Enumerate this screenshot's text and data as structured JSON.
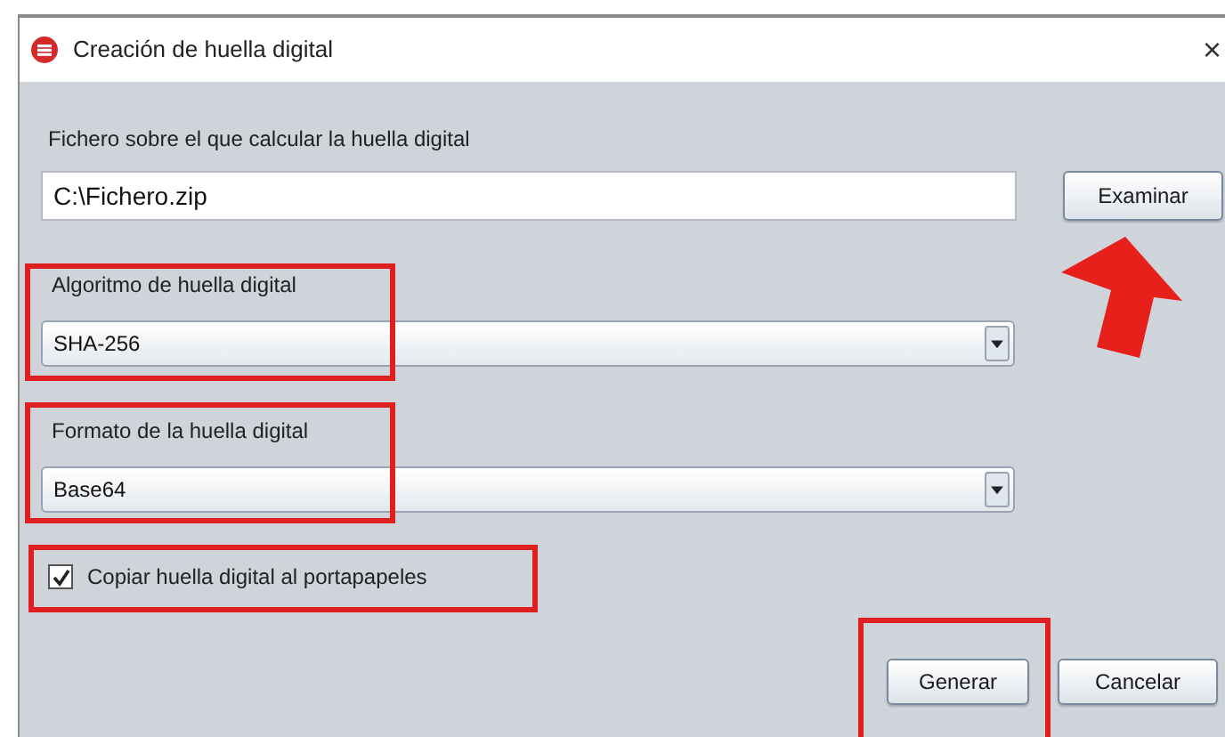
{
  "window": {
    "title": "Creación de huella digital",
    "close": "×"
  },
  "file": {
    "label": "Fichero sobre el que calcular la huella digital",
    "value": "C:\\Fichero.zip",
    "browse_button": "Examinar"
  },
  "selects": [
    {
      "label": "Algoritmo de huella digital",
      "value": "SHA-256"
    },
    {
      "label": "Formato de la huella digital",
      "value": "Base64"
    }
  ],
  "copy_checkbox": {
    "label": "Copiar huella digital al portapapeles",
    "checked": true
  },
  "buttons": [
    "Generar",
    "Cancelar"
  ]
}
